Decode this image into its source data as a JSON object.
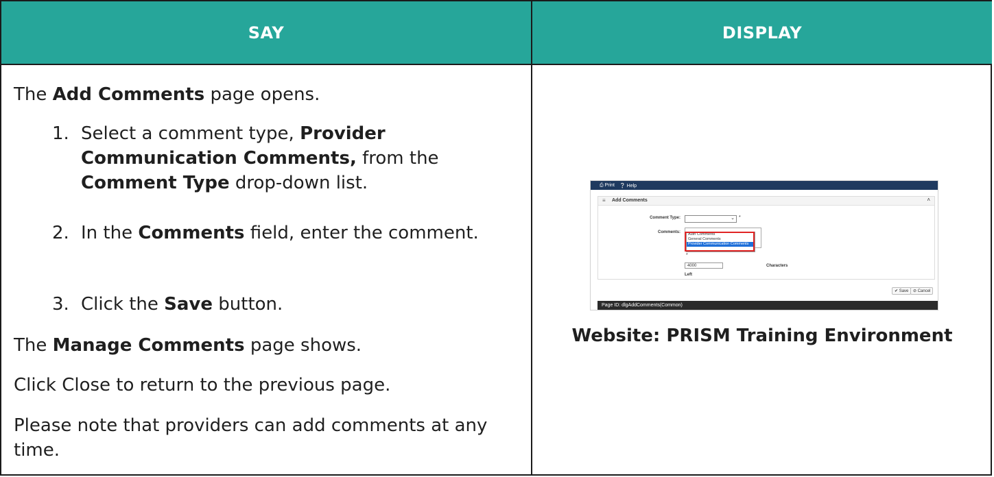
{
  "header": {
    "say": "SAY",
    "display": "DISPLAY"
  },
  "say": {
    "intro": {
      "strong": "Add Comments",
      "pre": "The ",
      "post": " page opens."
    },
    "steps": [
      {
        "num": "1.",
        "parts": [
          "Select a comment type, ",
          "Provider Communication Comments,",
          " from the ",
          "Comment Type",
          " drop-down list."
        ]
      },
      {
        "num": "2.",
        "parts": [
          "In the ",
          "Comments",
          " field, enter the comment."
        ]
      },
      {
        "num": "3.",
        "parts": [
          "Click the ",
          "Save",
          " button."
        ]
      }
    ],
    "manage": {
      "pre": "The ",
      "strong": "Manage Comments",
      "post": " page shows."
    },
    "close_text": "Click Close to return to the previous page.",
    "note": "Please note that providers can add comments at any time."
  },
  "display": {
    "toolbar": {
      "print": "Print",
      "help": "Help"
    },
    "panel_title": "Add Comments",
    "comment_type_label": "Comment Type:",
    "comments_label": "Comments:",
    "required_mark": "*",
    "options": [
      "Auth Comments",
      "General Comments",
      "Provider Communication Comments"
    ],
    "char_count": "4000",
    "characters_label": "Characters",
    "left_label": "Left",
    "save_button": "Save",
    "cancel_button": "Cancel",
    "page_id": "Page ID: dlgAddComments(Common)",
    "caption": "Website: PRISM Training Environment"
  }
}
